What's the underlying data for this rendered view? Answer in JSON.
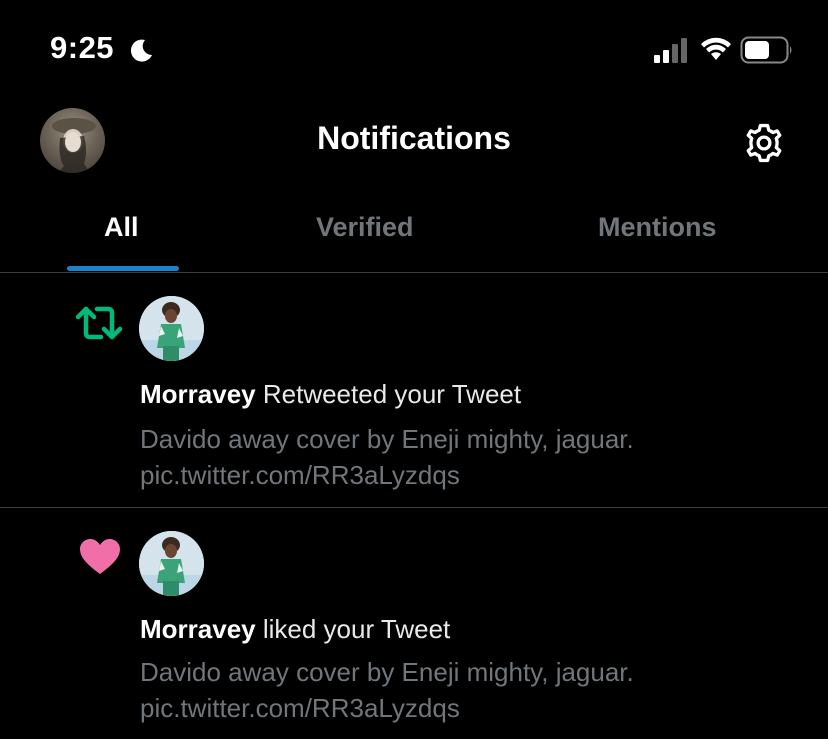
{
  "status_bar": {
    "time": "9:25"
  },
  "header": {
    "title": "Notifications"
  },
  "tabs": [
    {
      "label": "All",
      "active": true
    },
    {
      "label": "Verified",
      "active": false
    },
    {
      "label": "Mentions",
      "active": false
    }
  ],
  "notifications": [
    {
      "type": "retweet",
      "icon": "retweet-icon",
      "icon_color": "#00ba7c",
      "user": "Morravey",
      "action": "Retweeted your Tweet",
      "tweet_line1": "Davido away cover by Eneji mighty, jaguar.",
      "tweet_line2": "pic.twitter.com/RR3aLyzdqs"
    },
    {
      "type": "like",
      "icon": "heart-icon",
      "icon_color": "#f91880",
      "user": "Morravey",
      "action": "liked your Tweet",
      "tweet_line1": "Davido away cover by Eneji mighty, jaguar.",
      "tweet_line2": "pic.twitter.com/RR3aLyzdqs"
    }
  ],
  "colors": {
    "background": "#000000",
    "accent": "#1d9bf0",
    "secondary_text": "#71767b"
  }
}
